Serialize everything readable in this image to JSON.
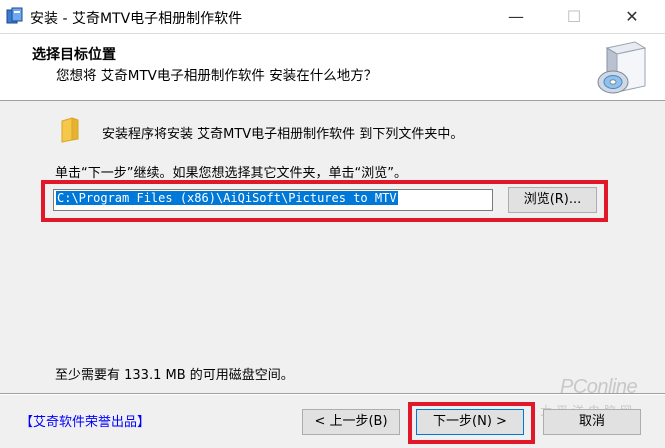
{
  "window": {
    "title": "安装 - 艾奇MTV电子相册制作软件",
    "minimize_symbol": "—",
    "maximize_symbol": "☐",
    "close_symbol": "✕"
  },
  "header": {
    "title": "选择目标位置",
    "subtitle": "您想将 艾奇MTV电子相册制作软件 安装在什么地方？"
  },
  "body": {
    "intro": "安装程序将安装 艾奇MTV电子相册制作软件 到下列文件夹中。",
    "instruction": "单击“下一步”继续。如果您想选择其它文件夹，单击“浏览”。",
    "path_value": "C:\\Program Files (x86)\\AiQiSoft\\Pictures to MTV",
    "browse_label": "浏览(R)...",
    "space_required": "至少需要有 133.1 MB 的可用磁盘空间。"
  },
  "footer": {
    "brand_link": "【艾奇软件荣誉出品】",
    "back_label": "< 上一步(B)",
    "next_label": "下一步(N) >",
    "cancel_label": "取消"
  },
  "watermark": {
    "main": "PConline",
    "sub": "太平洋电脑网"
  },
  "colors": {
    "highlight": "#e0182a",
    "selection": "#0078d7",
    "link": "#0000ff"
  },
  "icons": [
    "installer-app-icon",
    "folder-icon",
    "cd-box-icon"
  ]
}
